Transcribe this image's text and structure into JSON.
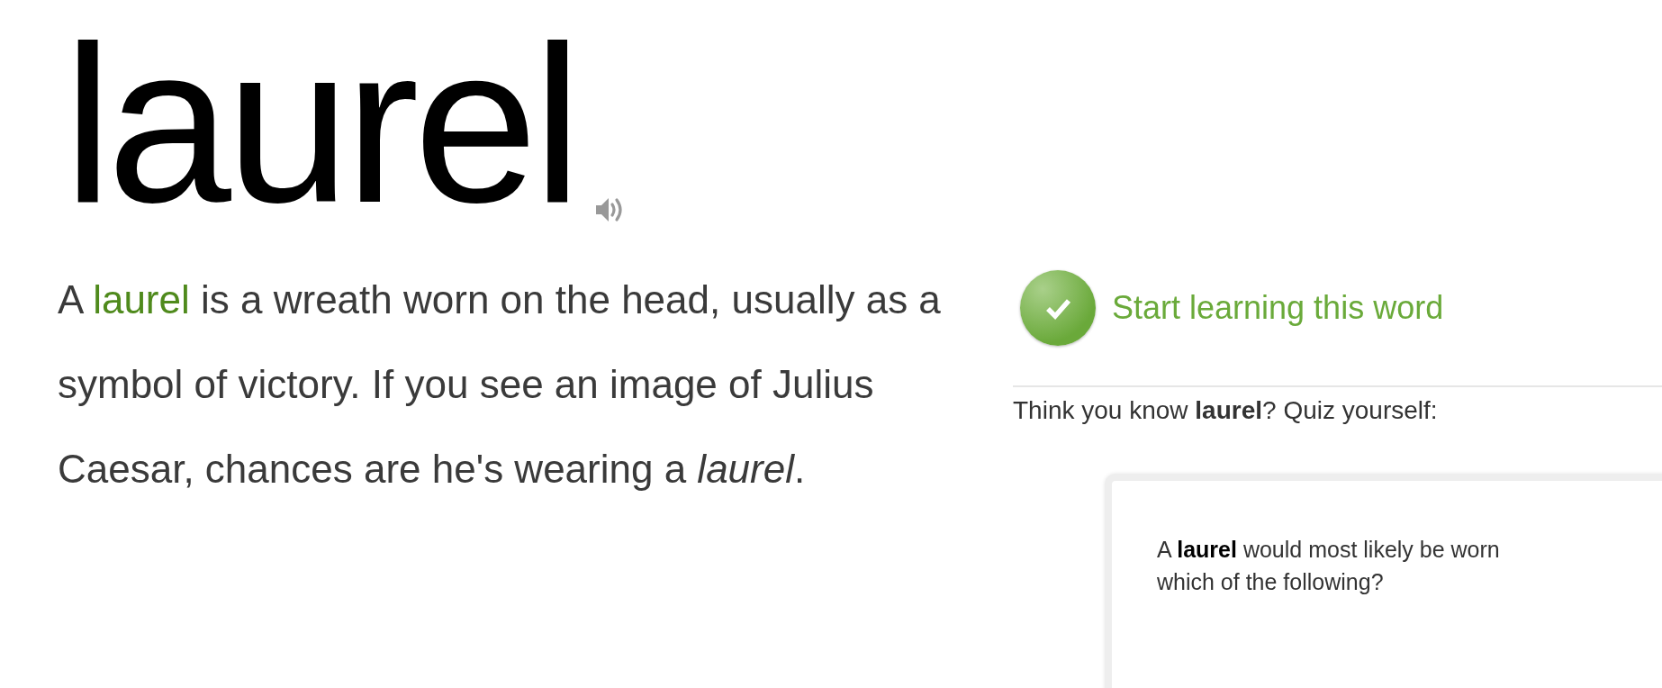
{
  "word": "laurel",
  "definition": [
    {
      "kind": "text",
      "text": "A "
    },
    {
      "kind": "link",
      "text": "laurel"
    },
    {
      "kind": "text",
      "text": " is a wreath worn on the head, usually as a symbol of victory. If you see an image of Julius Caesar, chances are he's wearing a *laurel*."
    }
  ],
  "learn_button": "Start learning this word",
  "quiz_prompt": "Think you know **laurel**? Quiz yourself:",
  "quiz_question": [
    "A **laurel** would most likely be worn",
    "which of the following?"
  ]
}
